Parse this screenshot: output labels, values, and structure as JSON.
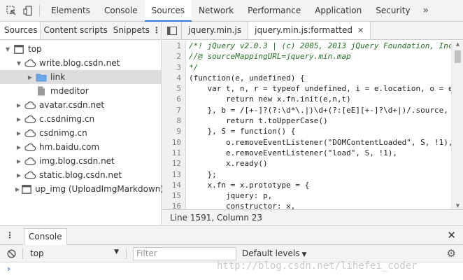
{
  "toolbar": {
    "tabs": [
      "Elements",
      "Console",
      "Sources",
      "Network",
      "Performance",
      "Application",
      "Security"
    ],
    "active_tab": "Sources",
    "more": "»"
  },
  "navigator": {
    "tabs": [
      "Sources",
      "Content scripts",
      "Snippets"
    ],
    "tree": [
      {
        "label": "top",
        "icon": "frame-icon",
        "expanded": true,
        "indent": 0
      },
      {
        "label": "write.blog.csdn.net",
        "icon": "cloud-icon",
        "expanded": true,
        "indent": 1
      },
      {
        "label": "link",
        "icon": "folder-icon",
        "expanded": false,
        "indent": 2,
        "selected": true
      },
      {
        "label": "mdeditor",
        "icon": "file-icon",
        "indent": 2
      },
      {
        "label": "avatar.csdn.net",
        "icon": "cloud-icon",
        "expanded": false,
        "indent": 1
      },
      {
        "label": "c.csdnimg.cn",
        "icon": "cloud-icon",
        "expanded": false,
        "indent": 1
      },
      {
        "label": "csdnimg.cn",
        "icon": "cloud-icon",
        "expanded": false,
        "indent": 1
      },
      {
        "label": "hm.baidu.com",
        "icon": "cloud-icon",
        "expanded": false,
        "indent": 1
      },
      {
        "label": "img.blog.csdn.net",
        "icon": "cloud-icon",
        "expanded": false,
        "indent": 1
      },
      {
        "label": "static.blog.csdn.net",
        "icon": "cloud-icon",
        "expanded": false,
        "indent": 1
      },
      {
        "label": "up_img (UploadImgMarkdown)",
        "icon": "frame-icon",
        "expanded": false,
        "indent": 1
      }
    ]
  },
  "editor": {
    "tabs": [
      {
        "label": "jquery.min.js",
        "active": false
      },
      {
        "label": "jquery.min.js:formatted",
        "active": true
      }
    ],
    "lines": [
      {
        "num": "1",
        "text": "/*! jQuery v2.0.3 | (c) 2005, 2013 jQuery Foundation, Inc",
        "kind": "comment"
      },
      {
        "num": "2",
        "text": "//@ sourceMappingURL=jquery.min.map",
        "kind": "comment"
      },
      {
        "num": "3",
        "text": "*/",
        "kind": "comment"
      },
      {
        "num": "4",
        "text": "(function(e, undefined) {",
        "kind": "code"
      },
      {
        "num": "5",
        "text": "    var t, n, r = typeof undefined, i = e.location, o = e",
        "kind": "code"
      },
      {
        "num": "6",
        "text": "        return new x.fn.init(e,n,t)",
        "kind": "code"
      },
      {
        "num": "7",
        "text": "    }, b = /[+-]?(?:\\d*\\.|)\\d+(?:[eE][+-]?\\d+|)/.source, w",
        "kind": "code"
      },
      {
        "num": "8",
        "text": "        return t.toUpperCase()",
        "kind": "code"
      },
      {
        "num": "9",
        "text": "    }, S = function() {",
        "kind": "code"
      },
      {
        "num": "10",
        "text": "        o.removeEventListener(\"DOMContentLoaded\", S, !1),",
        "kind": "code"
      },
      {
        "num": "11",
        "text": "        e.removeEventListener(\"load\", S, !1),",
        "kind": "code"
      },
      {
        "num": "12",
        "text": "        x.ready()",
        "kind": "code"
      },
      {
        "num": "13",
        "text": "    };",
        "kind": "code"
      },
      {
        "num": "14",
        "text": "    x.fn = x.prototype = {",
        "kind": "code"
      },
      {
        "num": "15",
        "text": "        jquery: p,",
        "kind": "code"
      },
      {
        "num": "16",
        "text": "        constructor: x,",
        "kind": "code"
      }
    ],
    "status": "Line 1591, Column 23"
  },
  "drawer": {
    "tab": "Console",
    "context": "top",
    "filter_placeholder": "Filter",
    "levels": "Default levels",
    "prompt": "›"
  },
  "watermark": "http://blog.csdn.net/lihefei_coder"
}
